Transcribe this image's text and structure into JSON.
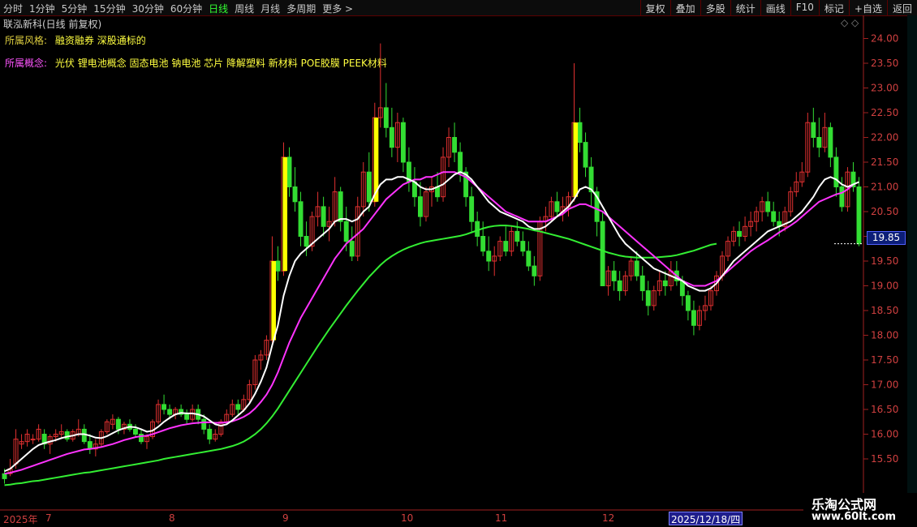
{
  "toolbar": {
    "periods": [
      "分时",
      "1分钟",
      "5分钟",
      "15分钟",
      "30分钟",
      "60分钟",
      "日线",
      "周线",
      "月线",
      "多周期",
      "更多"
    ],
    "active_period": "日线",
    "more_arrow": ">",
    "right_buttons": [
      "复权",
      "叠加",
      "多股",
      "统计",
      "画线",
      "F10",
      "标记",
      "+自选",
      "返回"
    ]
  },
  "stock_title": "联泓新科(日线 前复权)",
  "window_icons": "◇ ◇",
  "info": {
    "style_label": "所属风格:",
    "style_value": "融资融券 深股通标的",
    "concept_label": "所属概念:",
    "concept_value": "光伏 锂电池概念 固态电池 钠电池 芯片 降解塑料 新材料 POE胶膜 PEEK材料"
  },
  "current_price": "19.85",
  "date_highlight": "2025/12/18/四",
  "watermark": {
    "line1": "乐淘公式网",
    "line2": "www.60lt.com"
  },
  "colors": {
    "up": "#e03030",
    "down": "#33dd33",
    "ma_fast": "#ffffff",
    "ma_mid": "#ff33ff",
    "ma_slow": "#33ee33",
    "signal_bar": "#ffff00",
    "axis": "#d04040"
  },
  "chart_data": {
    "type": "candlestick",
    "y_axis": {
      "min": 15.0,
      "max": 24.0,
      "ticks": [
        "24.00",
        "23.50",
        "23.00",
        "22.50",
        "22.00",
        "21.50",
        "21.00",
        "20.50",
        "20.00",
        "19.50",
        "19.00",
        "18.50",
        "18.00",
        "17.50",
        "17.00",
        "16.50",
        "16.00",
        "15.50"
      ]
    },
    "x_labels": [
      "2025年",
      "7",
      "8",
      "9",
      "10",
      "11",
      "12"
    ],
    "candles": [
      [
        15.2,
        15.3,
        15.0,
        15.1
      ],
      [
        15.2,
        15.5,
        15.15,
        15.3
      ],
      [
        15.4,
        16.1,
        15.3,
        15.9
      ],
      [
        15.8,
        16.0,
        15.7,
        15.85
      ],
      [
        15.85,
        16.1,
        15.75,
        16.0
      ],
      [
        15.9,
        16.0,
        15.8,
        15.9
      ],
      [
        15.9,
        16.2,
        15.85,
        16.1
      ],
      [
        16.0,
        16.1,
        15.7,
        15.8
      ],
      [
        15.8,
        16.0,
        15.6,
        15.95
      ],
      [
        15.95,
        16.1,
        15.85,
        16.0
      ],
      [
        16.0,
        16.2,
        15.9,
        16.05
      ],
      [
        16.05,
        16.1,
        15.85,
        15.9
      ],
      [
        15.9,
        16.1,
        15.85,
        16.05
      ],
      [
        16.0,
        16.3,
        15.95,
        16.1
      ],
      [
        16.1,
        16.2,
        15.8,
        15.85
      ],
      [
        15.85,
        16.0,
        15.6,
        15.7
      ],
      [
        15.7,
        15.9,
        15.55,
        15.8
      ],
      [
        15.8,
        16.1,
        15.75,
        16.05
      ],
      [
        16.05,
        16.3,
        16.0,
        16.25
      ],
      [
        16.2,
        16.4,
        16.1,
        16.3
      ],
      [
        16.3,
        16.35,
        16.0,
        16.1
      ],
      [
        16.1,
        16.25,
        16.0,
        16.2
      ],
      [
        16.2,
        16.3,
        16.05,
        16.1
      ],
      [
        16.1,
        16.2,
        15.95,
        16.0
      ],
      [
        16.0,
        16.1,
        15.8,
        15.85
      ],
      [
        15.85,
        16.0,
        15.7,
        15.95
      ],
      [
        15.95,
        16.3,
        15.9,
        16.25
      ],
      [
        16.25,
        16.7,
        16.2,
        16.6
      ],
      [
        16.6,
        16.8,
        16.4,
        16.5
      ],
      [
        16.5,
        16.6,
        16.3,
        16.4
      ],
      [
        16.4,
        16.55,
        16.3,
        16.5
      ],
      [
        16.5,
        16.6,
        16.35,
        16.4
      ],
      [
        16.4,
        16.5,
        16.2,
        16.3
      ],
      [
        16.3,
        16.6,
        16.25,
        16.5
      ],
      [
        16.5,
        16.6,
        16.2,
        16.3
      ],
      [
        16.3,
        16.4,
        16.0,
        16.1
      ],
      [
        16.1,
        16.2,
        15.8,
        15.9
      ],
      [
        15.9,
        16.1,
        15.85,
        16.0
      ],
      [
        16.0,
        16.3,
        15.95,
        16.25
      ],
      [
        16.25,
        16.5,
        16.2,
        16.4
      ],
      [
        16.4,
        16.7,
        16.35,
        16.6
      ],
      [
        16.6,
        16.7,
        16.4,
        16.5
      ],
      [
        16.5,
        16.8,
        16.45,
        16.7
      ],
      [
        16.7,
        17.1,
        16.65,
        17.0
      ],
      [
        17.0,
        17.6,
        16.9,
        17.5
      ],
      [
        17.5,
        17.7,
        17.3,
        17.6
      ],
      [
        17.6,
        18.0,
        17.5,
        17.9
      ],
      [
        17.9,
        20.0,
        17.85,
        19.5
      ],
      [
        19.5,
        19.8,
        19.1,
        19.3
      ],
      [
        19.3,
        21.9,
        19.2,
        21.6
      ],
      [
        21.6,
        21.8,
        20.8,
        21.0
      ],
      [
        21.0,
        21.4,
        20.5,
        20.7
      ],
      [
        20.7,
        20.9,
        19.8,
        20.0
      ],
      [
        20.0,
        20.3,
        19.6,
        19.8
      ],
      [
        19.8,
        20.5,
        19.7,
        20.4
      ],
      [
        20.4,
        20.9,
        20.2,
        20.6
      ],
      [
        20.6,
        20.8,
        20.0,
        20.2
      ],
      [
        20.2,
        20.6,
        19.9,
        20.3
      ],
      [
        20.3,
        21.2,
        20.2,
        20.9
      ],
      [
        20.9,
        21.0,
        20.1,
        20.3
      ],
      [
        20.3,
        20.6,
        19.7,
        19.9
      ],
      [
        19.9,
        20.2,
        19.5,
        19.6
      ],
      [
        19.6,
        20.8,
        19.5,
        20.6
      ],
      [
        20.6,
        21.5,
        20.4,
        21.3
      ],
      [
        21.3,
        21.7,
        20.5,
        20.7
      ],
      [
        20.7,
        22.7,
        20.6,
        22.4
      ],
      [
        22.4,
        23.9,
        22.2,
        22.6
      ],
      [
        22.6,
        23.1,
        22.0,
        22.2
      ],
      [
        22.2,
        22.6,
        21.6,
        21.8
      ],
      [
        21.8,
        22.5,
        21.5,
        22.3
      ],
      [
        22.3,
        22.4,
        21.3,
        21.5
      ],
      [
        21.5,
        21.8,
        20.9,
        21.1
      ],
      [
        21.1,
        21.4,
        20.6,
        20.8
      ],
      [
        20.8,
        21.1,
        20.2,
        20.4
      ],
      [
        20.4,
        21.0,
        20.3,
        20.9
      ],
      [
        20.9,
        21.2,
        20.6,
        21.0
      ],
      [
        21.0,
        21.3,
        20.7,
        20.8
      ],
      [
        20.8,
        21.8,
        20.7,
        21.6
      ],
      [
        21.6,
        22.2,
        21.4,
        22.0
      ],
      [
        22.0,
        22.3,
        21.5,
        21.7
      ],
      [
        21.7,
        21.9,
        21.1,
        21.3
      ],
      [
        21.3,
        21.4,
        20.6,
        20.8
      ],
      [
        20.8,
        21.0,
        20.1,
        20.3
      ],
      [
        20.3,
        20.5,
        19.8,
        20.0
      ],
      [
        20.0,
        20.3,
        19.6,
        19.7
      ],
      [
        19.7,
        20.0,
        19.3,
        19.5
      ],
      [
        19.5,
        19.8,
        19.2,
        19.6
      ],
      [
        19.6,
        20.0,
        19.5,
        19.9
      ],
      [
        19.9,
        20.2,
        19.6,
        19.7
      ],
      [
        19.7,
        20.2,
        19.6,
        20.1
      ],
      [
        20.1,
        20.3,
        19.8,
        19.9
      ],
      [
        19.9,
        20.1,
        19.6,
        19.7
      ],
      [
        19.7,
        19.9,
        19.3,
        19.4
      ],
      [
        19.4,
        19.6,
        19.0,
        19.2
      ],
      [
        19.2,
        20.4,
        19.1,
        20.3
      ],
      [
        20.3,
        20.6,
        20.1,
        20.4
      ],
      [
        20.4,
        20.8,
        20.3,
        20.7
      ],
      [
        20.7,
        20.9,
        20.4,
        20.5
      ],
      [
        20.5,
        20.8,
        20.3,
        20.6
      ],
      [
        20.6,
        20.9,
        20.4,
        20.8
      ],
      [
        20.8,
        23.5,
        20.7,
        22.3
      ],
      [
        22.3,
        22.6,
        21.7,
        21.9
      ],
      [
        21.9,
        22.1,
        21.2,
        21.4
      ],
      [
        21.4,
        21.6,
        20.6,
        20.9
      ],
      [
        20.9,
        21.0,
        20.0,
        20.3
      ],
      [
        20.3,
        20.5,
        19.2,
        19.0
      ],
      [
        19.0,
        19.4,
        18.8,
        19.3
      ],
      [
        19.3,
        19.5,
        18.9,
        19.1
      ],
      [
        19.1,
        19.3,
        18.7,
        18.9
      ],
      [
        18.9,
        19.3,
        18.8,
        19.2
      ],
      [
        19.2,
        19.6,
        19.1,
        19.5
      ],
      [
        19.5,
        19.7,
        19.1,
        19.2
      ],
      [
        19.2,
        19.4,
        18.7,
        18.9
      ],
      [
        18.9,
        19.1,
        18.4,
        18.6
      ],
      [
        18.6,
        19.0,
        18.5,
        18.9
      ],
      [
        18.9,
        19.3,
        18.8,
        19.1
      ],
      [
        19.1,
        19.3,
        18.8,
        19.0
      ],
      [
        19.0,
        19.5,
        18.9,
        19.3
      ],
      [
        19.3,
        19.5,
        19.0,
        19.1
      ],
      [
        19.1,
        19.2,
        18.6,
        18.8
      ],
      [
        18.8,
        18.9,
        18.3,
        18.5
      ],
      [
        18.5,
        18.7,
        18.0,
        18.2
      ],
      [
        18.2,
        18.6,
        18.1,
        18.5
      ],
      [
        18.5,
        18.8,
        18.3,
        18.6
      ],
      [
        18.6,
        19.0,
        18.5,
        18.9
      ],
      [
        18.9,
        19.3,
        18.8,
        19.2
      ],
      [
        19.2,
        19.7,
        19.1,
        19.6
      ],
      [
        19.6,
        20.0,
        19.5,
        19.9
      ],
      [
        19.9,
        20.2,
        19.8,
        20.1
      ],
      [
        20.1,
        20.3,
        19.8,
        20.0
      ],
      [
        20.0,
        20.4,
        19.9,
        20.2
      ],
      [
        20.2,
        20.5,
        20.0,
        20.3
      ],
      [
        20.3,
        20.6,
        20.1,
        20.5
      ],
      [
        20.5,
        20.8,
        20.3,
        20.7
      ],
      [
        20.7,
        20.9,
        20.4,
        20.5
      ],
      [
        20.5,
        20.7,
        20.2,
        20.3
      ],
      [
        20.3,
        20.5,
        20.0,
        20.2
      ],
      [
        20.2,
        20.6,
        20.1,
        20.5
      ],
      [
        20.5,
        21.0,
        20.4,
        20.9
      ],
      [
        20.9,
        21.3,
        20.8,
        21.1
      ],
      [
        21.1,
        21.5,
        21.0,
        21.3
      ],
      [
        21.3,
        22.5,
        21.2,
        22.3
      ],
      [
        22.3,
        22.6,
        21.8,
        22.0
      ],
      [
        22.0,
        22.4,
        21.6,
        21.8
      ],
      [
        21.8,
        22.5,
        21.7,
        22.2
      ],
      [
        22.2,
        22.3,
        21.4,
        21.6
      ],
      [
        21.6,
        21.8,
        20.8,
        21.0
      ],
      [
        21.0,
        21.2,
        20.5,
        20.6
      ],
      [
        20.6,
        21.4,
        20.5,
        21.3
      ],
      [
        21.3,
        21.5,
        20.9,
        21.0
      ],
      [
        21.0,
        21.2,
        19.8,
        19.85
      ]
    ],
    "ma_fast": [
      15.25,
      15.3,
      15.4,
      15.5,
      15.6,
      15.7,
      15.78,
      15.82,
      15.85,
      15.88,
      15.92,
      15.95,
      15.97,
      16.0,
      16.0,
      15.97,
      15.93,
      15.92,
      15.96,
      16.02,
      16.08,
      16.12,
      16.15,
      16.14,
      16.1,
      16.05,
      16.07,
      16.15,
      16.25,
      16.33,
      16.4,
      16.43,
      16.42,
      16.42,
      16.4,
      16.36,
      16.28,
      16.2,
      16.17,
      16.2,
      16.28,
      16.38,
      16.48,
      16.62,
      16.82,
      17.06,
      17.35,
      17.8,
      18.2,
      18.8,
      19.2,
      19.5,
      19.65,
      19.75,
      19.85,
      19.95,
      20.05,
      20.15,
      20.3,
      20.35,
      20.35,
      20.3,
      20.35,
      20.5,
      20.6,
      20.85,
      21.05,
      21.15,
      21.15,
      21.2,
      21.2,
      21.15,
      21.1,
      21.0,
      20.95,
      20.95,
      21.0,
      21.05,
      21.15,
      21.25,
      21.3,
      21.25,
      21.15,
      21.0,
      20.85,
      20.7,
      20.6,
      20.5,
      20.45,
      20.4,
      20.35,
      20.3,
      20.2,
      20.15,
      20.15,
      20.2,
      20.3,
      20.4,
      20.5,
      20.6,
      20.75,
      20.95,
      21.0,
      20.95,
      20.8,
      20.6,
      20.4,
      20.2,
      20.0,
      19.85,
      19.75,
      19.65,
      19.55,
      19.45,
      19.35,
      19.3,
      19.25,
      19.2,
      19.15,
      19.1,
      19.0,
      18.95,
      18.9,
      18.9,
      18.95,
      19.05,
      19.2,
      19.35,
      19.5,
      19.6,
      19.7,
      19.8,
      19.9,
      20.0,
      20.1,
      20.15,
      20.2,
      20.25,
      20.3,
      20.4,
      20.5,
      20.65,
      20.8,
      21.0,
      21.15,
      21.2,
      21.15,
      21.05,
      21.0,
      21.05,
      21.1
    ],
    "ma_mid": [
      15.2,
      15.22,
      15.25,
      15.28,
      15.32,
      15.36,
      15.4,
      15.44,
      15.48,
      15.52,
      15.56,
      15.6,
      15.63,
      15.66,
      15.69,
      15.7,
      15.72,
      15.74,
      15.77,
      15.8,
      15.84,
      15.88,
      15.91,
      15.94,
      15.96,
      15.97,
      16.0,
      16.04,
      16.08,
      16.12,
      16.15,
      16.18,
      16.2,
      16.22,
      16.23,
      16.24,
      16.24,
      16.23,
      16.23,
      16.24,
      16.26,
      16.3,
      16.35,
      16.42,
      16.52,
      16.65,
      16.8,
      17.0,
      17.25,
      17.55,
      17.85,
      18.1,
      18.35,
      18.55,
      18.75,
      18.95,
      19.15,
      19.35,
      19.55,
      19.7,
      19.85,
      19.95,
      20.05,
      20.15,
      20.3,
      20.45,
      20.6,
      20.75,
      20.85,
      20.95,
      21.05,
      21.1,
      21.15,
      21.15,
      21.2,
      21.2,
      21.25,
      21.3,
      21.3,
      21.3,
      21.25,
      21.2,
      21.1,
      21.0,
      20.9,
      20.8,
      20.7,
      20.6,
      20.5,
      20.45,
      20.4,
      20.35,
      20.3,
      20.3,
      20.3,
      20.3,
      20.35,
      20.4,
      20.45,
      20.55,
      20.6,
      20.65,
      20.65,
      20.6,
      20.55,
      20.5,
      20.4,
      20.3,
      20.2,
      20.1,
      20.0,
      19.9,
      19.8,
      19.7,
      19.6,
      19.5,
      19.4,
      19.3,
      19.2,
      19.1,
      19.05,
      19.0,
      19.0,
      19.0,
      19.05,
      19.1,
      19.2,
      19.3,
      19.4,
      19.5,
      19.6,
      19.7,
      19.78,
      19.85,
      19.92,
      20.0,
      20.08,
      20.15,
      20.22,
      20.3,
      20.4,
      20.5,
      20.6,
      20.7,
      20.75,
      20.8,
      20.85,
      20.88,
      20.95,
      21.05
    ],
    "ma_slow": [
      14.97,
      14.98,
      15.0,
      15.01,
      15.03,
      15.05,
      15.06,
      15.08,
      15.1,
      15.12,
      15.14,
      15.16,
      15.18,
      15.2,
      15.22,
      15.23,
      15.25,
      15.27,
      15.29,
      15.31,
      15.33,
      15.35,
      15.37,
      15.39,
      15.41,
      15.43,
      15.45,
      15.47,
      15.5,
      15.52,
      15.54,
      15.56,
      15.58,
      15.6,
      15.62,
      15.64,
      15.66,
      15.68,
      15.7,
      15.73,
      15.76,
      15.8,
      15.85,
      15.92,
      16.0,
      16.1,
      16.22,
      16.36,
      16.52,
      16.7,
      16.88,
      17.06,
      17.24,
      17.42,
      17.6,
      17.78,
      17.95,
      18.12,
      18.28,
      18.44,
      18.6,
      18.75,
      18.9,
      19.04,
      19.18,
      19.3,
      19.42,
      19.52,
      19.6,
      19.67,
      19.73,
      19.78,
      19.82,
      19.86,
      19.89,
      19.91,
      19.93,
      19.95,
      19.97,
      19.99,
      20.01,
      20.04,
      20.08,
      20.12,
      20.16,
      20.19,
      20.21,
      20.22,
      20.22,
      20.21,
      20.19,
      20.17,
      20.15,
      20.12,
      20.1,
      20.07,
      20.04,
      20.01,
      19.98,
      19.95,
      19.91,
      19.87,
      19.83,
      19.79,
      19.75,
      19.71,
      19.67,
      19.64,
      19.61,
      19.59,
      19.58,
      19.57,
      19.57,
      19.57,
      19.57,
      19.58,
      19.59,
      19.6,
      19.62,
      19.65,
      19.68,
      19.71,
      19.75,
      19.79,
      19.83,
      19.85
    ]
  }
}
